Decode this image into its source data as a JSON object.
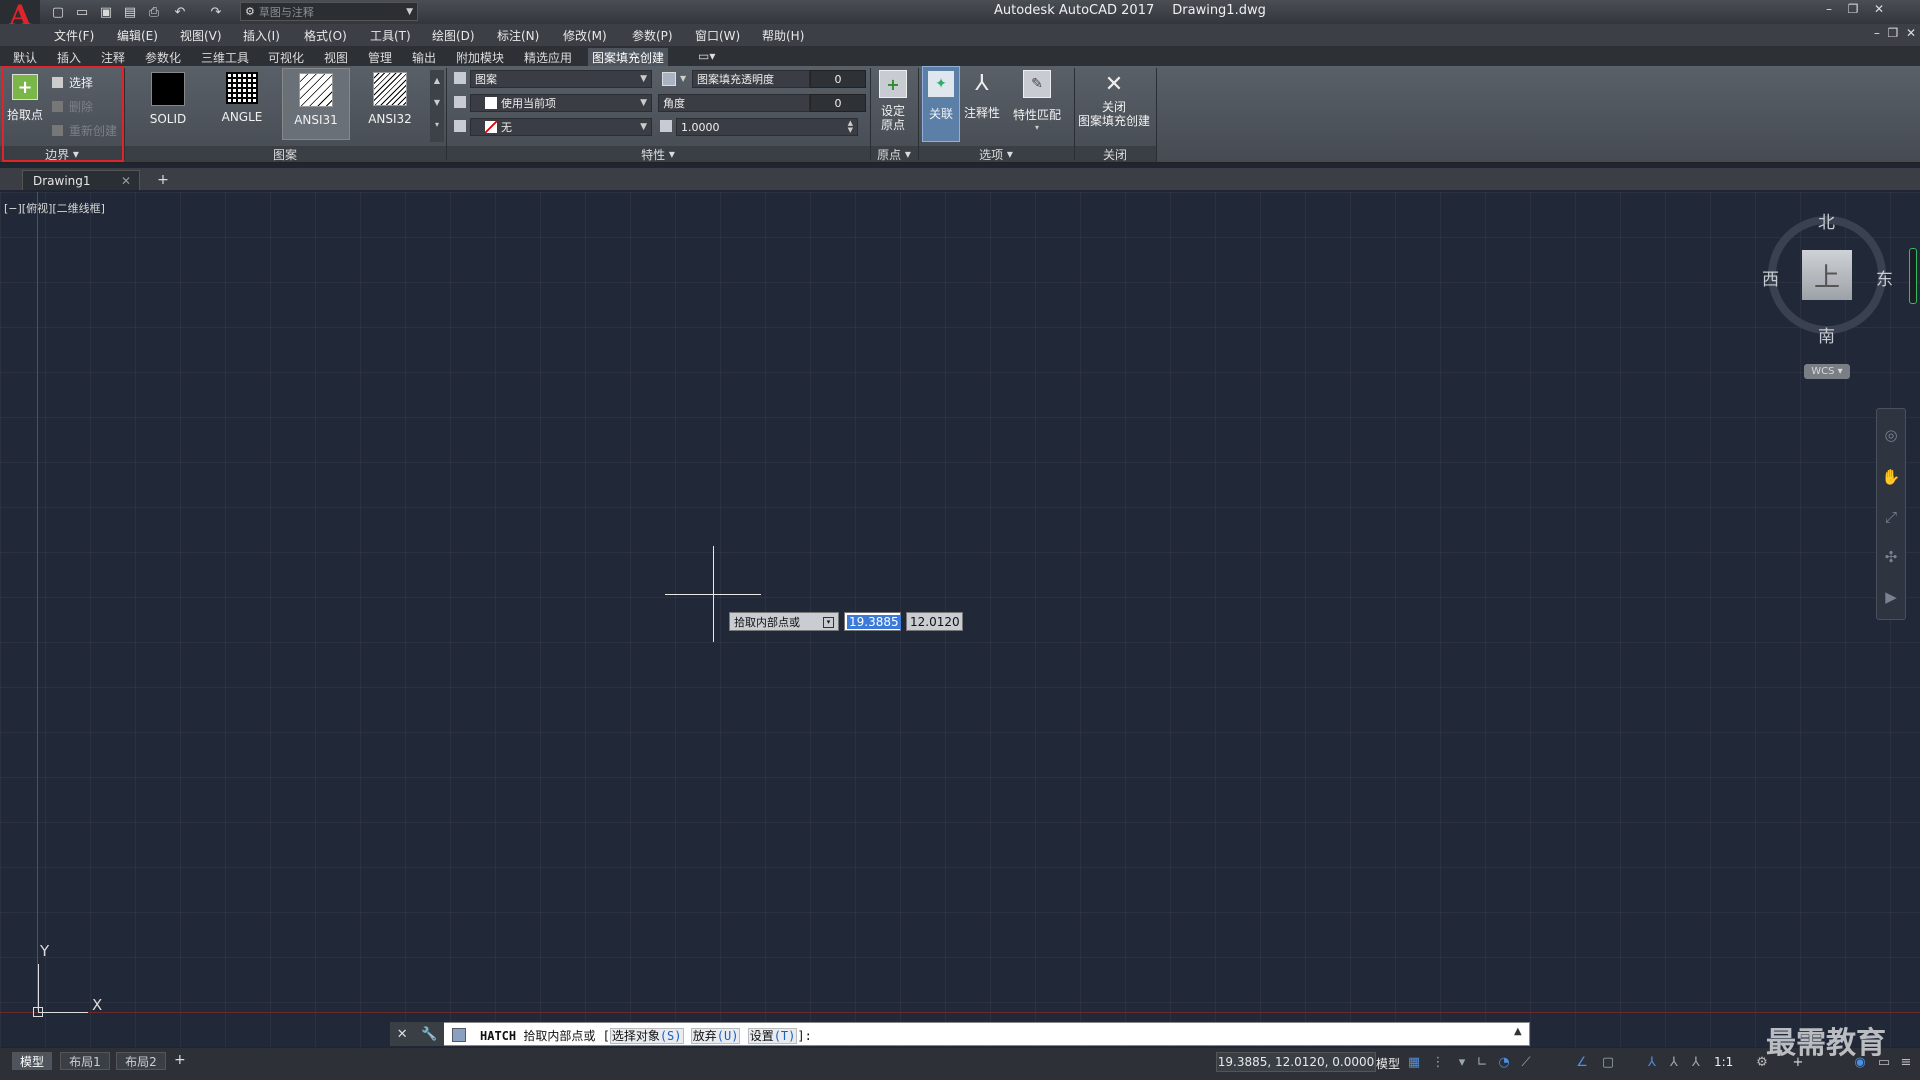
{
  "title": {
    "app": "Autodesk AutoCAD 2017",
    "file": "Drawing1.dwg"
  },
  "quick_access": {
    "workspace": "草图与注释"
  },
  "menu": [
    "文件(F)",
    "编辑(E)",
    "视图(V)",
    "插入(I)",
    "格式(O)",
    "工具(T)",
    "绘图(D)",
    "标注(N)",
    "修改(M)",
    "参数(P)",
    "窗口(W)",
    "帮助(H)"
  ],
  "ribbon_tabs": [
    "默认",
    "插入",
    "注释",
    "参数化",
    "三维工具",
    "可视化",
    "视图",
    "管理",
    "输出",
    "附加模块",
    "精选应用",
    "图案填充创建"
  ],
  "ribbon": {
    "boundary": {
      "pick_point": "拾取点",
      "select": "选择",
      "remove": "删除",
      "recreate": "重新创建",
      "panel": "边界"
    },
    "pattern": {
      "items": [
        "SOLID",
        "ANGLE",
        "ANSI31",
        "ANSI32"
      ],
      "panel": "图案"
    },
    "properties": {
      "type": "图案",
      "color": "使用当前项",
      "bg": "无",
      "transparency_label": "图案填充透明度",
      "transparency": "0",
      "angle_label": "角度",
      "angle": "0",
      "scale": "1.0000",
      "panel": "特性"
    },
    "origin": {
      "set_origin_1": "设定",
      "set_origin_2": "原点",
      "panel": "原点"
    },
    "options": {
      "associative": "关联",
      "annotative": "注释性",
      "match": "特性匹配",
      "panel": "选项"
    },
    "close": {
      "label_1": "关闭",
      "label_2": "图案填充创建",
      "panel": "关闭"
    }
  },
  "file_tab": "Drawing1",
  "viewport_label": "[−][俯视][二维线框]",
  "viewcube": {
    "north": "北",
    "south": "南",
    "east": "东",
    "west": "西",
    "face": "上",
    "wcs": "WCS"
  },
  "dynamic_input": {
    "prompt": "拾取内部点或",
    "x": "19.3885",
    "y": "12.0120"
  },
  "ucs": {
    "x": "X",
    "y": "Y"
  },
  "command": {
    "cmd": "HATCH",
    "prompt": "拾取内部点或 [",
    "opt1": "选择对象",
    "key1": "(S)",
    "opt2": "放弃",
    "key2": "(U)",
    "opt3": "设置",
    "key3": "(T)",
    "end": "]:"
  },
  "layout_tabs": [
    "模型",
    "布局1",
    "布局2"
  ],
  "status": {
    "coords": "19.3885, 12.0120, 0.0000",
    "model": "模型",
    "scale": "1:1"
  },
  "watermark": "最需教育"
}
